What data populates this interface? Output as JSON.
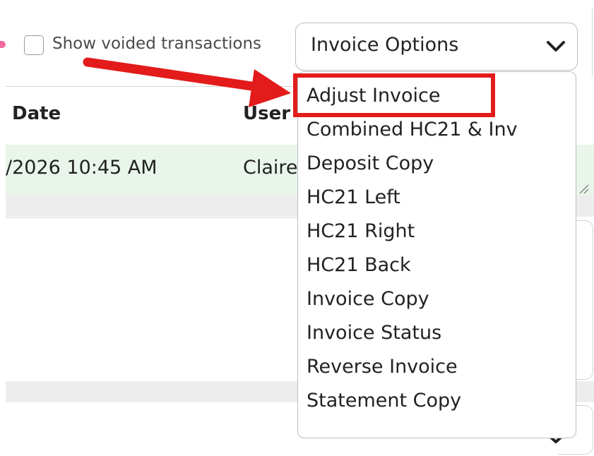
{
  "filters": {
    "show_voided_label": "Show voided transactions",
    "show_voided_checked": false
  },
  "invoice_select": {
    "selected": "Invoice Options",
    "options": [
      "Adjust Invoice",
      "Combined HC21 & Inv",
      "Deposit Copy",
      "HC21 Left",
      "HC21 Right",
      "HC21 Back",
      "Invoice Copy",
      "Invoice Status",
      "Reverse Invoice",
      "Statement Copy"
    ]
  },
  "table": {
    "headers": [
      "Date",
      "User"
    ],
    "row": {
      "date": "/2026 10:45 AM",
      "user": "Claire"
    }
  },
  "colors": {
    "arrow": "#e31b1b",
    "row_highlight": "#e9f5ea",
    "band": "#ededed"
  }
}
